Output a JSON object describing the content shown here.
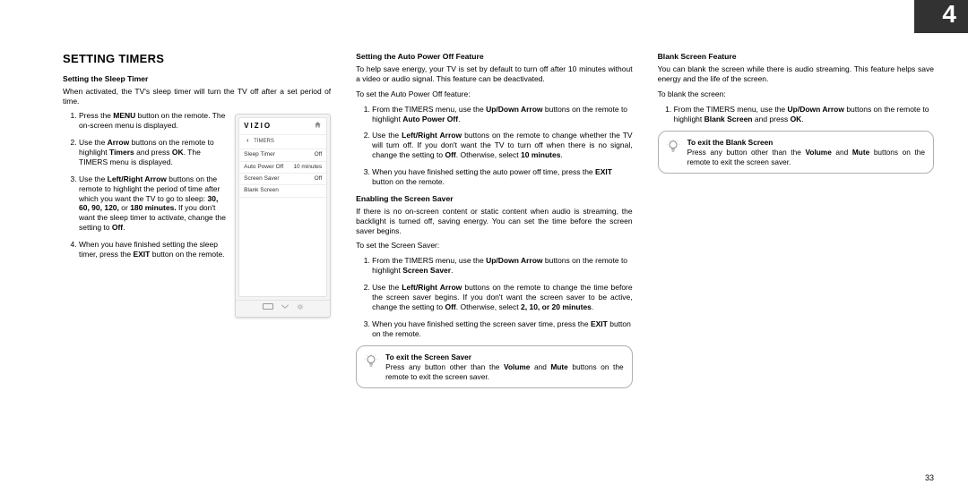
{
  "chapter_number": "4",
  "page_number": "33",
  "heading": "SETTING TIMERS",
  "col1": {
    "sub": "Setting the Sleep Timer",
    "intro": "When activated, the TV's sleep timer will turn the TV off after a set period of time.",
    "step1_a": "Press the ",
    "step1_b_bold": "MENU",
    "step1_c": " button on the remote. The on-screen menu is displayed.",
    "step2_a": "Use the ",
    "step2_b_bold": "Arrow",
    "step2_c": " buttons on the remote to highlight ",
    "step2_d_bold": "Timers",
    "step2_e": " and press ",
    "step2_f_bold": "OK",
    "step2_g": ". The TIMERS menu is displayed.",
    "step3_a": "Use the ",
    "step3_b_bold": "Left/Right Arrow",
    "step3_c": " buttons on the remote to highlight the period of time after which you want the TV to go to sleep: ",
    "step3_d_bold": "30, 60, 90, 120,",
    "step3_e": " or ",
    "step3_f_bold": "180 minutes.",
    "step3_g": " If you don't want the sleep timer to activate, change the setting to ",
    "step3_h_bold": "Off",
    "step3_i": ".",
    "step4_a": "When you have finished setting the sleep timer, press the ",
    "step4_b_bold": "EXIT",
    "step4_c": " button on the remote."
  },
  "menu": {
    "brand": "VIZIO",
    "crumb": "TIMERS",
    "rows": [
      {
        "label": "Sleep Timer",
        "value": "Off"
      },
      {
        "label": "Auto Power Off",
        "value": "10 minutes"
      },
      {
        "label": "Screen Saver",
        "value": "Off"
      },
      {
        "label": "Blank Screen",
        "value": ""
      }
    ]
  },
  "col2": {
    "autoPower": {
      "sub": "Setting the Auto Power Off Feature",
      "intro": "To help save energy, your TV is set by default to turn off after 10 minutes without a video or audio signal. This feature can be deactivated.",
      "lead": "To set the Auto Power Off feature:",
      "s1_a": "From the TIMERS menu, use the ",
      "s1_b_bold": "Up/Down Arrow",
      "s1_c": " buttons on the remote to highlight ",
      "s1_d_bold": "Auto Power Off",
      "s1_e": ".",
      "s2_a": "Use the ",
      "s2_b_bold": "Left/Right Arrow",
      "s2_c": " buttons on the remote to change whether the TV will turn off. If you don't want the TV to turn off when there is no signal, change the setting to ",
      "s2_d_bold": "Off",
      "s2_e": ". Otherwise, select ",
      "s2_f_bold": "10 minutes",
      "s2_g": ".",
      "s3_a": "When you have finished setting the auto power off time, press the ",
      "s3_b_bold": "EXIT",
      "s3_c": " button on the remote."
    },
    "screenSaver": {
      "sub": "Enabling the Screen Saver",
      "intro": "If there is no on-screen content or static content when audio is streaming, the backlight is turned off, saving energy. You can set the time before the screen saver begins.",
      "lead": "To set the Screen Saver:",
      "s1_a": "From the TIMERS menu, use the ",
      "s1_b_bold": "Up/Down Arrow",
      "s1_c": " buttons on the remote to highlight ",
      "s1_d_bold": "Screen Saver",
      "s1_e": ".",
      "s2_a": "Use the ",
      "s2_b_bold": "Left/Right Arrow",
      "s2_c": " buttons on the remote to change the time before the screen saver begins. If you don't want the screen saver to be active, change the setting to ",
      "s2_d_bold": "Off",
      "s2_e": ". Otherwise, select ",
      "s2_f_bold": "2, 10, or 20 minutes",
      "s2_g": ".",
      "s3_a": "When you have finished setting the screen saver time, press the ",
      "s3_b_bold": "EXIT",
      "s3_c": " button on the remote."
    },
    "tip": {
      "head": "To exit the Screen Saver",
      "body_a": "Press any button other than the ",
      "body_b_bold": "Volume",
      "body_c": " and ",
      "body_d_bold": "Mute",
      "body_e": " buttons on the remote to exit the screen saver."
    }
  },
  "col3": {
    "blank": {
      "sub": "Blank Screen Feature",
      "intro": "You can blank the screen while there is audio streaming. This feature helps save energy and the life of the screen.",
      "lead": "To blank the screen:",
      "s1_a": "From the TIMERS menu, use the ",
      "s1_b_bold": "Up/Down Arrow",
      "s1_c": " buttons on the remote to highlight ",
      "s1_d_bold": "Blank Screen",
      "s1_e": " and press ",
      "s1_f_bold": "OK",
      "s1_g": "."
    },
    "tip": {
      "head": "To exit the Blank Screen",
      "body_a": "Press any button other than the ",
      "body_b_bold": "Volume",
      "body_c": " and ",
      "body_d_bold": "Mute",
      "body_e": " buttons on the remote to exit the screen saver."
    }
  }
}
